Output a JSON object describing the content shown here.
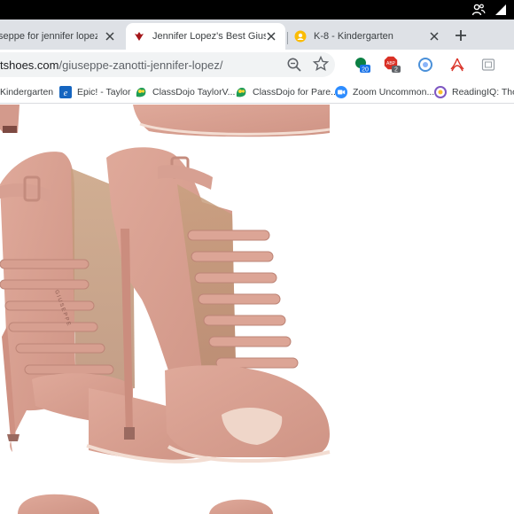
{
  "browser": {
    "tabs": [
      {
        "title": "seppe for jennifer lopez - Yo",
        "active": false
      },
      {
        "title": "Jennifer Lopez's Best Giuseppe",
        "active": true
      },
      {
        "title": "K-8 - Kindergarten",
        "active": false
      }
    ],
    "address": {
      "host": "tshoes.com",
      "path": "/giuseppe-zanotti-jennifer-lopez/"
    },
    "extensions": [
      {
        "name": "calendar-extension-icon",
        "badge": "20",
        "badge_color": "#1a73e8"
      },
      {
        "name": "adblock-extension-icon",
        "badge": "2",
        "badge_color": "#5f6368"
      },
      {
        "name": "circle-extension-icon"
      },
      {
        "name": "pdf-extension-icon"
      },
      {
        "name": "screenshot-extension-icon"
      }
    ],
    "bookmarks": [
      {
        "label": "Kindergarten",
        "icon": "none"
      },
      {
        "label": "Epic! - Taylor",
        "icon": "epic-icon"
      },
      {
        "label": "ClassDojo TaylorV...",
        "icon": "classdojo-icon"
      },
      {
        "label": "ClassDojo for Pare...",
        "icon": "classdojo-icon"
      },
      {
        "label": "Zoom Uncommon...",
        "icon": "zoom-icon"
      },
      {
        "label": "ReadingIQ: Thous",
        "icon": "readingiq-icon"
      }
    ]
  },
  "colors": {
    "os_bar": "#000000",
    "tabstrip": "#dee1e6",
    "active_tab": "#ffffff",
    "omnibox": "#f1f3f4",
    "shoe_suede": "#d9a293",
    "shoe_shadow": "#b8807a",
    "sole_edge": "#f3ddd2"
  },
  "page": {
    "image": "giuseppe-zanotti-blush-suede-caged-heels"
  }
}
